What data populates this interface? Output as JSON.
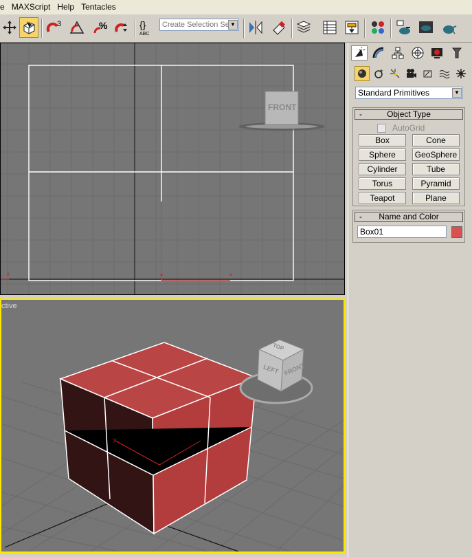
{
  "menu": [
    "e",
    "MAXScript",
    "Help",
    "Tentacles"
  ],
  "toolbar": {
    "selection_set_placeholder": "Create Selection Set",
    "icons": [
      "select-and-move-icon",
      "select-object-icon",
      "snaps-toggle-icon",
      "angle-snap-icon",
      "percent-snap-icon",
      "spinner-snap-icon",
      "edit-named-selections-icon",
      "mirror-icon",
      "align-icon",
      "layer-manager-icon",
      "curve-editor-icon",
      "schematic-view-icon",
      "material-editor-icon",
      "render-setup-icon",
      "rendered-frame-icon",
      "quick-render-icon"
    ],
    "snap_label": "3",
    "abc_label": "ABC"
  },
  "viewports": {
    "top": {
      "label": "",
      "viewcube_face": "FRONT"
    },
    "perspective": {
      "label": "ctive",
      "viewcube_faces": [
        "TOP",
        "LEFT",
        "FRONT"
      ],
      "selected": true
    }
  },
  "command_panel": {
    "tabs": [
      "create-tab",
      "modify-tab",
      "hierarchy-tab",
      "motion-tab",
      "display-tab",
      "utilities-tab"
    ],
    "subtabs": [
      "geometry",
      "shapes",
      "lights",
      "cameras",
      "helpers",
      "space-warps",
      "systems"
    ],
    "category": "Standard Primitives",
    "object_type": {
      "title": "Object Type",
      "collapse": "-",
      "autogrid_label": "AutoGrid",
      "autogrid_checked": false,
      "buttons": [
        "Box",
        "Cone",
        "Sphere",
        "GeoSphere",
        "Cylinder",
        "Tube",
        "Torus",
        "Pyramid",
        "Teapot",
        "Plane"
      ]
    },
    "name_color": {
      "title": "Name and Color",
      "collapse": "-",
      "name": "Box01",
      "color": "#d95252"
    }
  },
  "colors": {
    "viewport_bg": "#767676",
    "active_viewport_border": "#ffe600",
    "box_color": "#b83c3c"
  }
}
